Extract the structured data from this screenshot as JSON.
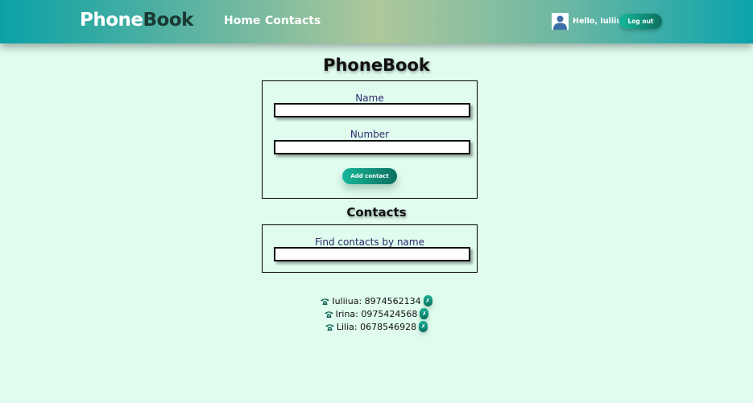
{
  "header": {
    "logo_part1": "Phone",
    "logo_part2": "Book",
    "nav": [
      {
        "label": "Home"
      },
      {
        "label": "Contacts"
      }
    ],
    "user": {
      "greeting": "Hello, Iuliiua",
      "logout_label": "Log out"
    }
  },
  "main": {
    "title": "PhoneBook",
    "add_form": {
      "name_label": "Name",
      "name_value": "",
      "number_label": "Number",
      "number_value": "",
      "submit_label": "Add contact"
    },
    "contacts_title": "Contacts",
    "filter": {
      "label": "Find contacts by name",
      "value": ""
    },
    "contacts": [
      {
        "name": "Iuliiua",
        "number": "8974562134"
      },
      {
        "name": "Irina",
        "number": "0975424568"
      },
      {
        "name": "Lilia",
        "number": "0678546928"
      }
    ],
    "delete_glyph": "✗"
  },
  "colors": {
    "background": "#dffcee",
    "accent": "#0c8f7a",
    "label_text": "#2c2a6e"
  }
}
